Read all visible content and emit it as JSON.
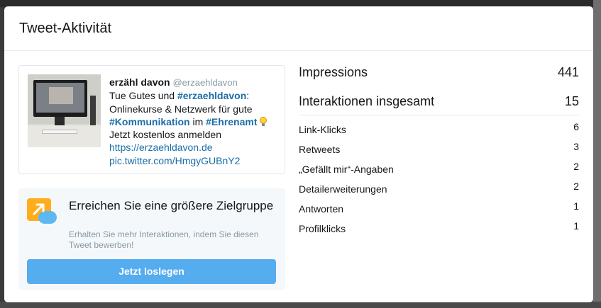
{
  "modal": {
    "title": "Tweet-Aktivität"
  },
  "tweet": {
    "author_name": "erzähl davon",
    "author_handle": "@erzaehldavon",
    "text_1": "Tue Gutes und ",
    "hashtag_1": "#erzaehldavon",
    "text_2": ": Onlinekurse & Netzwerk für gute ",
    "hashtag_2": "#Kommunikation",
    "text_3": " im ",
    "hashtag_3": "#Ehrenamt",
    "text_4": "Jetzt kostenlos anmelden",
    "link_1": "https://erzaehldavon.de",
    "link_2": "pic.twitter.com/HmgyGUBnY2"
  },
  "promo": {
    "title": "Erreichen Sie eine größere Zielgruppe",
    "subtitle": "Erhalten Sie mehr Interaktionen, indem Sie diesen Tweet bewerben!",
    "button_label": "Jetzt loslegen"
  },
  "stats": {
    "impressions_label": "Impressions",
    "impressions_value": "441",
    "interactions_label": "Interaktionen insgesamt",
    "interactions_value": "15",
    "items": [
      {
        "label": "Link-Klicks",
        "value": "6"
      },
      {
        "label": "Retweets",
        "value": "3"
      },
      {
        "label": "„Gefällt mir“-Angaben",
        "value": "2"
      },
      {
        "label": "Detailerweiterungen",
        "value": "2"
      },
      {
        "label": "Antworten",
        "value": "1"
      },
      {
        "label": "Profilklicks",
        "value": "1"
      }
    ]
  },
  "colors": {
    "accent": "#55acee",
    "link": "#1b6ea8",
    "text": "#14171a",
    "muted": "#8899a6"
  }
}
